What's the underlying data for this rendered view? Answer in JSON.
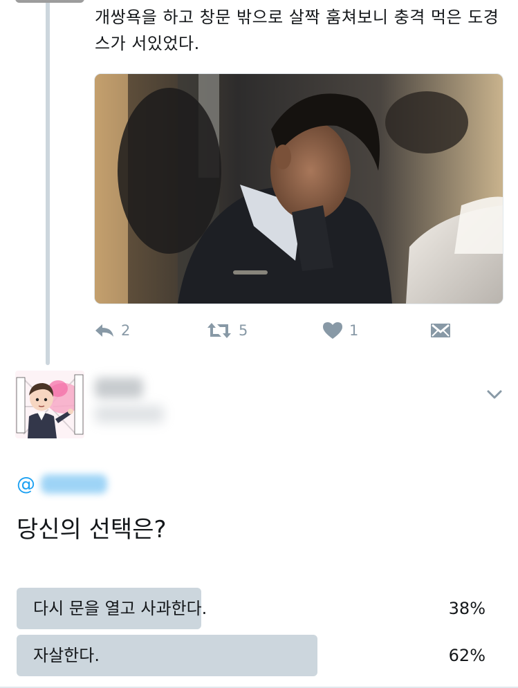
{
  "tweet": {
    "text": "개쌍욕을 하고 창문 밖으로 살짝 훔쳐보니 충격 먹은 도경스가 서있었다.",
    "actions": {
      "reply_count": "2",
      "retweet_count": "5",
      "like_count": "1"
    },
    "icons": [
      "reply-icon",
      "retweet-icon",
      "like-icon",
      "direct-message-icon"
    ]
  },
  "reply": {
    "mention_prefix": "@",
    "question": "당신의 선택은?",
    "poll": [
      {
        "label": "다시 문을 열고 사과한다.",
        "percent": "38%",
        "fraction": 0.38
      },
      {
        "label": "자살한다.",
        "percent": "62%",
        "fraction": 0.62
      }
    ]
  },
  "colors": {
    "accent": "#1da1f2",
    "action_gray": "#8899a6",
    "poll_bar": "#ccd6dd",
    "thread_line": "#ccd6dd"
  }
}
